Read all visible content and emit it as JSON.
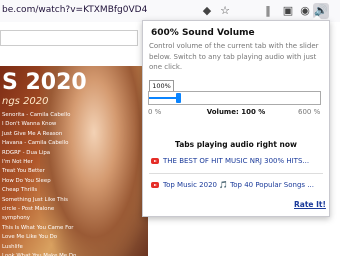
{
  "browser": {
    "url": "be.com/watch?v=KTXMBfg0VD4",
    "icons": [
      "star-icon",
      "library-icon",
      "sidebar-icon",
      "extension-icon",
      "volume-icon"
    ]
  },
  "video": {
    "title": "S 2020",
    "subtitle": "ngs 2020",
    "tracks": [
      "Senorita - Camila Cabello",
      "I Don't Wanna Know",
      "Just Give Me A Reason",
      "Havana - Camila Cabello",
      "RDGRF - Dua Lipa",
      "I'm Not Her",
      "Treat You Better",
      "How Do You Sleep",
      "Cheap Thrills",
      "Something Just Like This",
      "circle - Post Malone",
      "symphony",
      "This Is What You Came For",
      "Love Me Like You Do",
      "Lushlife",
      "Look What You Make Me Do"
    ]
  },
  "popup": {
    "title": "600% Sound Volume",
    "description": "Control volume of the current tab with the slider below. Switch to any tab playing audio with just one click.",
    "volume_value": "100%",
    "slider_min_label": "0 %",
    "slider_max_label": "600 %",
    "volume_readout": "Volume: 100 %",
    "volume_fraction": 0.1667,
    "tabs_header": "Tabs playing audio right now",
    "tabs": [
      {
        "label": "THE BEST OF HIT MUSIC NRJ 300% HITS..."
      },
      {
        "label": "Top Music 2020 🎵 Top 40 Popular Songs ..."
      }
    ],
    "rate_label": "Rate It!"
  },
  "colors": {
    "accent": "#0a84ff",
    "link": "#1a3a9a",
    "youtube": "#e52d27"
  }
}
